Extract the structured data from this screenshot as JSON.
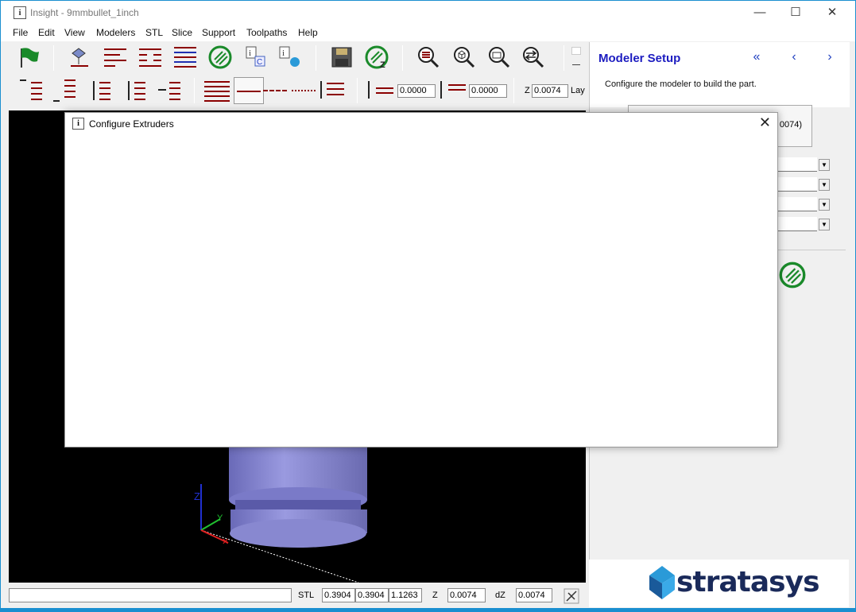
{
  "window": {
    "title": "Insight - 9mmbullet_1inch",
    "minimize": "—",
    "maximize": "☐",
    "close": "✕"
  },
  "menu": [
    "File",
    "Edit",
    "View",
    "Modelers",
    "STL",
    "Slice",
    "Support",
    "Toolpaths",
    "Help"
  ],
  "toolbar2": {
    "offset1": "0.0000",
    "offset2": "0.0000",
    "z_label": "Z",
    "z_value": "0.0074",
    "lay_label": "Lay"
  },
  "right_panel": {
    "title": "Modeler Setup",
    "description": "Configure the modeler to build the part.",
    "button_partial": "0074)",
    "nav": {
      "first": "«",
      "prev": "‹",
      "next": "›"
    }
  },
  "status": {
    "stl_label": "STL",
    "stl_x": "0.3904",
    "stl_y": "0.3904",
    "stl_z": "1.1263",
    "z_label": "Z",
    "z_value": "0.0074",
    "dz_label": "dZ",
    "dz_value": "0.0074"
  },
  "dialog": {
    "title": "Configure Extruders",
    "close": "✕"
  },
  "viewport": {
    "axis_z": "Z",
    "axis_y": "Y"
  },
  "logo": "stratasys",
  "colors": {
    "accent_blue": "#1c1cc0",
    "toolbar_red": "#8b0000",
    "icon_green": "#1a8a2a",
    "model_color": "#8a8ad0"
  }
}
